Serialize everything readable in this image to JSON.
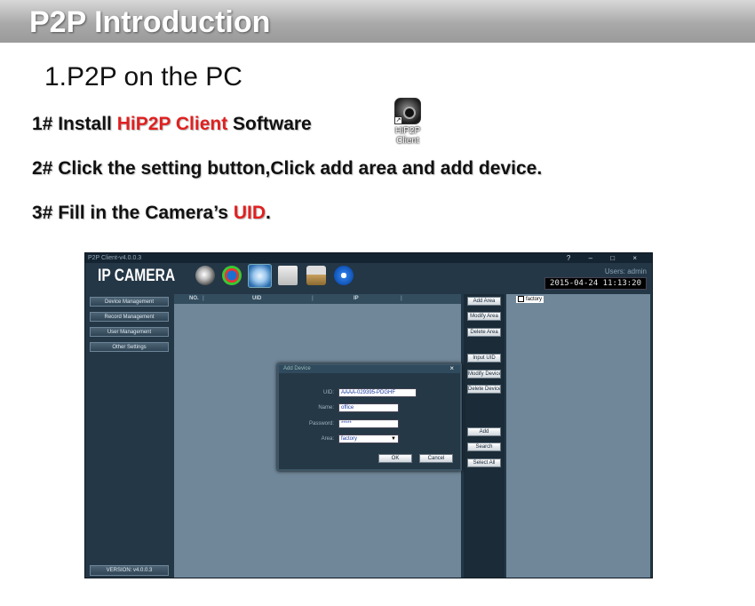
{
  "banner": {
    "title": "P2P Introduction"
  },
  "heading": "1.P2P on the PC",
  "steps": {
    "s1": {
      "prefix": "1# Install ",
      "highlight": "HiP2P Client",
      "suffix": " Software"
    },
    "s2": {
      "text": "2# Click the setting button,Click add area and add device."
    },
    "s3": {
      "prefix": "3# Fill in the Camera’s ",
      "highlight": "UID",
      "suffix": "."
    }
  },
  "desktop_icon": {
    "label_line1": "HiP2P",
    "label_line2": "Client",
    "icon": "hip2p-client-icon"
  },
  "app": {
    "window_title": "P2P Client-v4.0.0.3",
    "window_controls": "? – □ ×",
    "logo": "IP CAMERA",
    "users": "Users: admin",
    "clock": "2015-04-24  11:13:20",
    "toolbar_icons": [
      "webcam-icon",
      "playback-icon",
      "settings-icon",
      "map-icon",
      "lock-icon",
      "power-icon"
    ],
    "sidebar": [
      "Device Management",
      "Record Management",
      "User Management",
      "Other Settings"
    ],
    "version": "VERSION: v4.0.0.3",
    "grid_headers": {
      "no": "NO.",
      "uid": "UID",
      "ip": "IP"
    },
    "mid_buttons": {
      "add_area": "Add Area",
      "modify_area": "Modify Area",
      "delete_area": "Delete Area",
      "input_uid": "Input UID",
      "modify_device": "Modify Device",
      "delete_device": "Delete Device",
      "add": "Add",
      "search": "Search",
      "select_all": "Select All"
    },
    "tree": {
      "item": "factory"
    },
    "dialog": {
      "title": "Add Device",
      "close": "×",
      "uid_label": "UID:",
      "uid_value": "AAAA-029395-PDGHF",
      "name_label": "Name:",
      "name_value": "office",
      "password_label": "Password:",
      "password_value": "*****",
      "area_label": "Area:",
      "area_value": "factory",
      "ok": "OK",
      "cancel": "Cancel"
    }
  },
  "colors": {
    "accent_red": "#e02020",
    "app_bg": "#243746",
    "panel": "#6f8799"
  }
}
